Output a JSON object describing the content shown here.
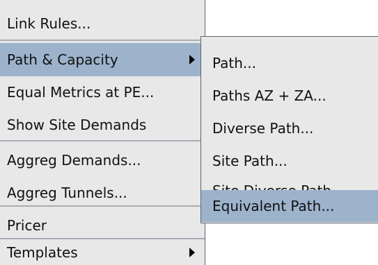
{
  "main_menu": {
    "items": [
      {
        "label": "Link Rules..."
      },
      {
        "label": "Path & Capacity"
      },
      {
        "label": "Equal Metrics at PE..."
      },
      {
        "label": "Show Site Demands"
      },
      {
        "label": "Aggreg Demands..."
      },
      {
        "label": "Aggreg Tunnels..."
      },
      {
        "label": "Pricer"
      },
      {
        "label": "Templates"
      }
    ]
  },
  "sub_menu": {
    "items": [
      {
        "label": "Path..."
      },
      {
        "label": "Paths AZ + ZA..."
      },
      {
        "label": "Diverse Path..."
      },
      {
        "label": "Site Path..."
      },
      {
        "label": "Site Diverse Path..."
      },
      {
        "label": "Equivalent Path..."
      }
    ]
  },
  "colors": {
    "menu_bg": "#e8e8e8",
    "selected_bg": "#9db3cc",
    "border": "#5a6370",
    "separator": "#a7adb4",
    "text": "#111111"
  },
  "icons": {
    "submenu_arrow": "chevron-right-icon"
  }
}
